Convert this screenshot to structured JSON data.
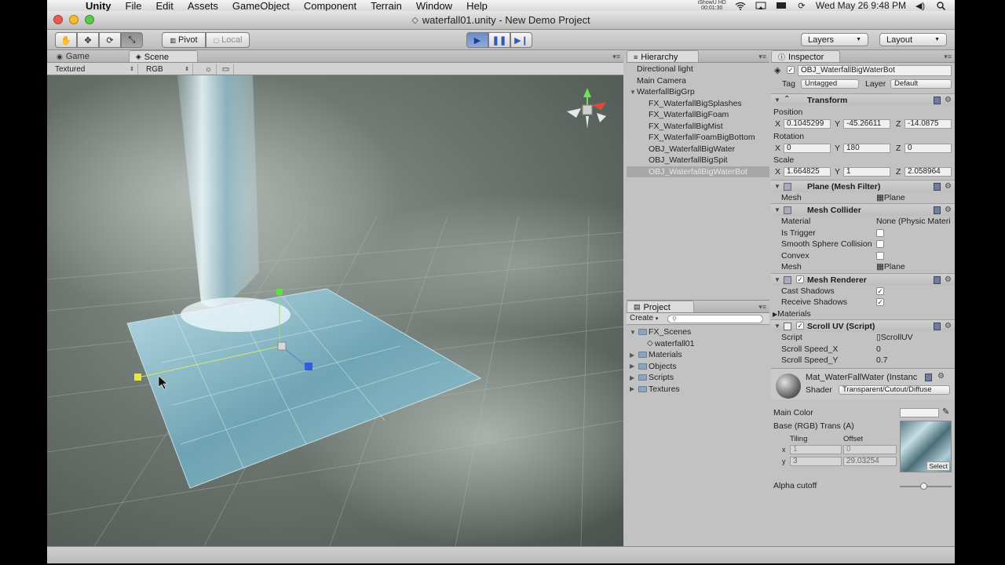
{
  "menubar": {
    "app": "Unity",
    "items": [
      "File",
      "Edit",
      "Assets",
      "GameObject",
      "Component",
      "Terrain",
      "Window",
      "Help"
    ],
    "ishow_line1": "iShowU HD",
    "ishow_line2": "00:01:30",
    "clock": "Wed May 26  9:48 PM"
  },
  "window": {
    "title": "waterfall01.unity - New Demo Project"
  },
  "toolbar": {
    "pivot": "Pivot",
    "local": "Local",
    "layers": "Layers",
    "layout": "Layout"
  },
  "scene": {
    "tab_game": "Game",
    "tab_scene": "Scene",
    "render_mode": "Textured",
    "color_mode": "RGB"
  },
  "hierarchy": {
    "tab": "Hierarchy",
    "items": [
      {
        "label": "Directional light",
        "level": 0
      },
      {
        "label": "Main Camera",
        "level": 0
      },
      {
        "label": "WaterfallBigGrp",
        "level": 0,
        "expanded": true
      },
      {
        "label": "FX_WaterfallBigSplashes",
        "level": 1
      },
      {
        "label": "FX_WaterfallBigFoam",
        "level": 1
      },
      {
        "label": "FX_WaterfallBigMist",
        "level": 1
      },
      {
        "label": "FX_WaterfallFoamBigBottom",
        "level": 1
      },
      {
        "label": "OBJ_WaterfallBigWater",
        "level": 1
      },
      {
        "label": "OBJ_WaterfallBigSpit",
        "level": 1
      },
      {
        "label": "OBJ_WaterfallBigWaterBot",
        "level": 1,
        "selected": true
      }
    ]
  },
  "project": {
    "tab": "Project",
    "create": "Create",
    "items": [
      {
        "label": "FX_Scenes",
        "level": 0,
        "expanded": true
      },
      {
        "label": "waterfall01",
        "level": 1
      },
      {
        "label": "Materials",
        "level": 0
      },
      {
        "label": "Objects",
        "level": 0
      },
      {
        "label": "Scripts",
        "level": 0
      },
      {
        "label": "Textures",
        "level": 0
      }
    ]
  },
  "inspector": {
    "tab": "Inspector",
    "object_name": "OBJ_WaterfallBigWaterBot",
    "tag_label": "Tag",
    "tag_value": "Untagged",
    "layer_label": "Layer",
    "layer_value": "Default",
    "transform": {
      "title": "Transform",
      "position_label": "Position",
      "position": {
        "x": "0.1045299",
        "y": "-45.26611",
        "z": "-14.0875"
      },
      "rotation_label": "Rotation",
      "rotation": {
        "x": "0",
        "y": "180",
        "z": "0"
      },
      "scale_label": "Scale",
      "scale": {
        "x": "1.664825",
        "y": "1",
        "z": "2.058964"
      }
    },
    "mesh_filter": {
      "title": "Plane (Mesh Filter)",
      "mesh_label": "Mesh",
      "mesh_value": "Plane"
    },
    "mesh_collider": {
      "title": "Mesh Collider",
      "material_label": "Material",
      "material_value": "None (Physic Materi",
      "is_trigger": "Is Trigger",
      "smooth_sphere": "Smooth Sphere Collision",
      "convex": "Convex",
      "mesh_label": "Mesh",
      "mesh_value": "Plane"
    },
    "mesh_renderer": {
      "title": "Mesh Renderer",
      "cast_shadows": "Cast Shadows",
      "receive_shadows": "Receive Shadows",
      "materials": "Materials"
    },
    "scroll_uv": {
      "title": "Scroll UV (Script)",
      "script_label": "Script",
      "script_value": "ScrollUV",
      "speed_x_label": "Scroll Speed_X",
      "speed_x": "0",
      "speed_y_label": "Scroll Speed_Y",
      "speed_y": "0.7"
    },
    "material": {
      "name": "Mat_WaterFallWater (Instanc",
      "shader_label": "Shader",
      "shader_value": "Transparent/Cutout/Diffuse",
      "main_color": "Main Color",
      "base_label": "Base (RGB) Trans (A)",
      "tiling": "Tiling",
      "offset": "Offset",
      "tiling_x": "1",
      "tiling_y": "3",
      "offset_x": "0",
      "offset_y": "29.03254",
      "select": "Select",
      "alpha_cutoff": "Alpha cutoff",
      "alpha_value": 0.46
    }
  }
}
